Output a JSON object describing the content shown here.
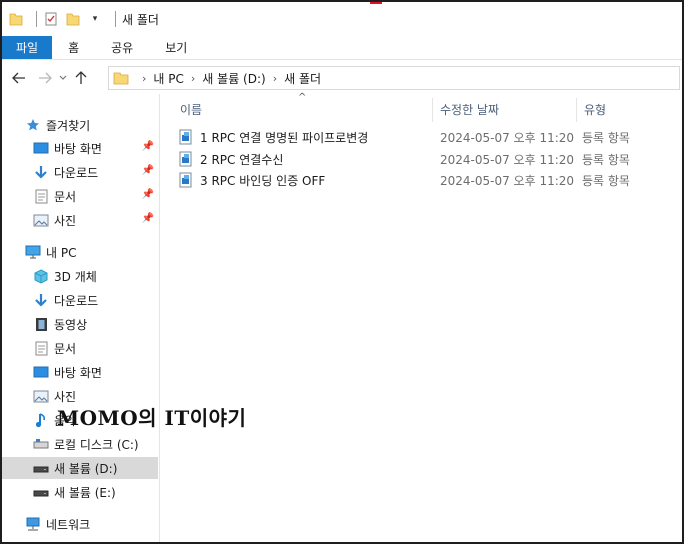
{
  "window": {
    "title": "새 폴더"
  },
  "ribbon": {
    "tabs": [
      "파일",
      "홈",
      "공유",
      "보기"
    ]
  },
  "address": {
    "crumbs": [
      "내 PC",
      "새 볼륨 (D:)",
      "새 폴더"
    ]
  },
  "nav": {
    "quick_access": "즐겨찾기",
    "quick_items": [
      "바탕 화면",
      "다운로드",
      "문서",
      "사진"
    ],
    "this_pc": "내 PC",
    "pc_items": [
      "3D 개체",
      "다운로드",
      "동영상",
      "문서",
      "바탕 화면",
      "사진",
      "음악",
      "로컬 디스크 (C:)",
      "새 볼륨 (D:)",
      "새 볼륨 (E:)"
    ],
    "network": "네트워크"
  },
  "columns": {
    "name": "이름",
    "modified": "수정한 날짜",
    "type": "유형"
  },
  "files": [
    {
      "name": "1 RPC 연결 명명된 파이프로변경",
      "modified": "2024-05-07 오후 11:20",
      "type": "등록 항목"
    },
    {
      "name": "2 RPC 연결수신",
      "modified": "2024-05-07 오후 11:20",
      "type": "등록 항목"
    },
    {
      "name": "3 RPC 바인딩 인증 OFF",
      "modified": "2024-05-07 오후 11:20",
      "type": "등록 항목"
    }
  ],
  "watermark": {
    "text": "MOMO의 IT이야기"
  },
  "colors": {
    "file_tab": "#1979ca",
    "selected": "#d9d9d9",
    "folder": "#f8d775"
  }
}
